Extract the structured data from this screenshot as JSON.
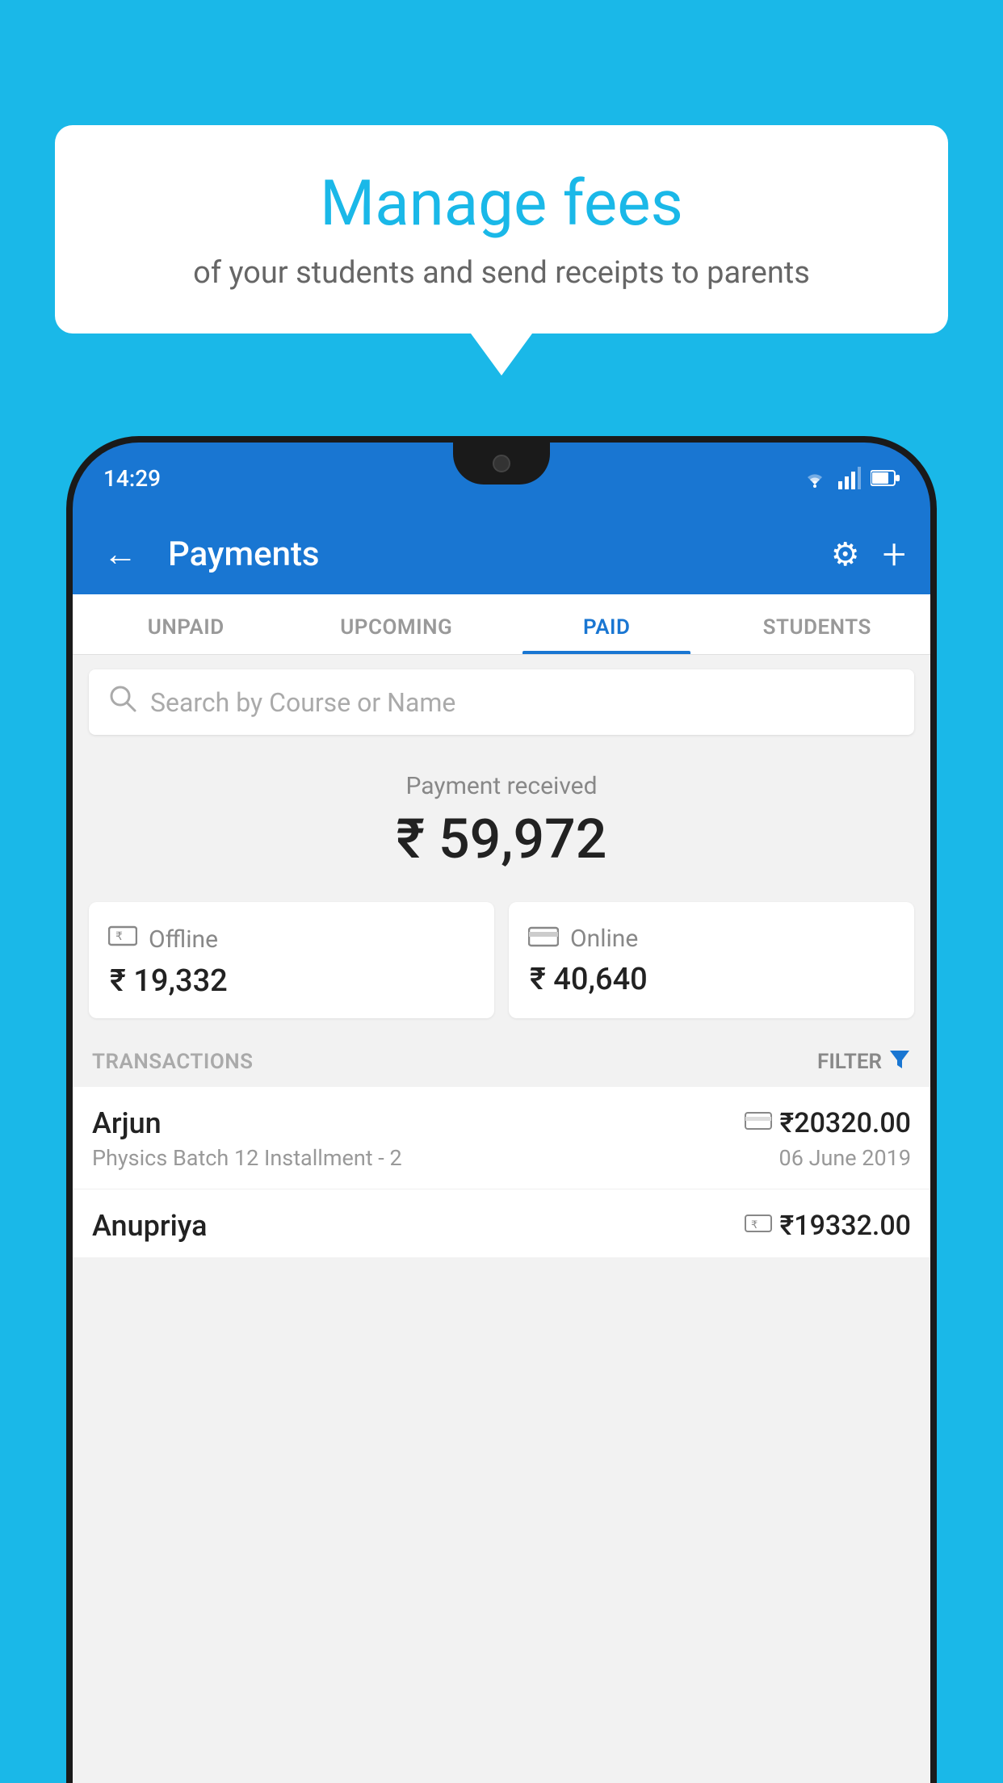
{
  "background": {
    "color": "#1ab8e8"
  },
  "speech_bubble": {
    "title": "Manage fees",
    "subtitle": "of your students and send receipts to parents"
  },
  "phone": {
    "status_bar": {
      "time": "14:29",
      "icons": [
        "wifi",
        "signal",
        "battery"
      ]
    },
    "header": {
      "back_label": "←",
      "title": "Payments",
      "settings_icon": "⚙",
      "add_icon": "+"
    },
    "tabs": [
      {
        "label": "UNPAID",
        "active": false
      },
      {
        "label": "UPCOMING",
        "active": false
      },
      {
        "label": "PAID",
        "active": true
      },
      {
        "label": "STUDENTS",
        "active": false
      }
    ],
    "search": {
      "placeholder": "Search by Course or Name",
      "icon": "search"
    },
    "payment_received": {
      "label": "Payment received",
      "amount": "₹ 59,972"
    },
    "payment_cards": [
      {
        "type": "Offline",
        "amount": "₹ 19,332",
        "icon": "offline"
      },
      {
        "type": "Online",
        "amount": "₹ 40,640",
        "icon": "online"
      }
    ],
    "transactions_section": {
      "label": "TRANSACTIONS",
      "filter_label": "FILTER"
    },
    "transactions": [
      {
        "name": "Arjun",
        "detail": "Physics Batch 12 Installment - 2",
        "amount": "₹20320.00",
        "date": "06 June 2019",
        "payment_type": "online"
      },
      {
        "name": "Anupriya",
        "detail": "",
        "amount": "₹19332.00",
        "date": "",
        "payment_type": "offline"
      }
    ]
  }
}
